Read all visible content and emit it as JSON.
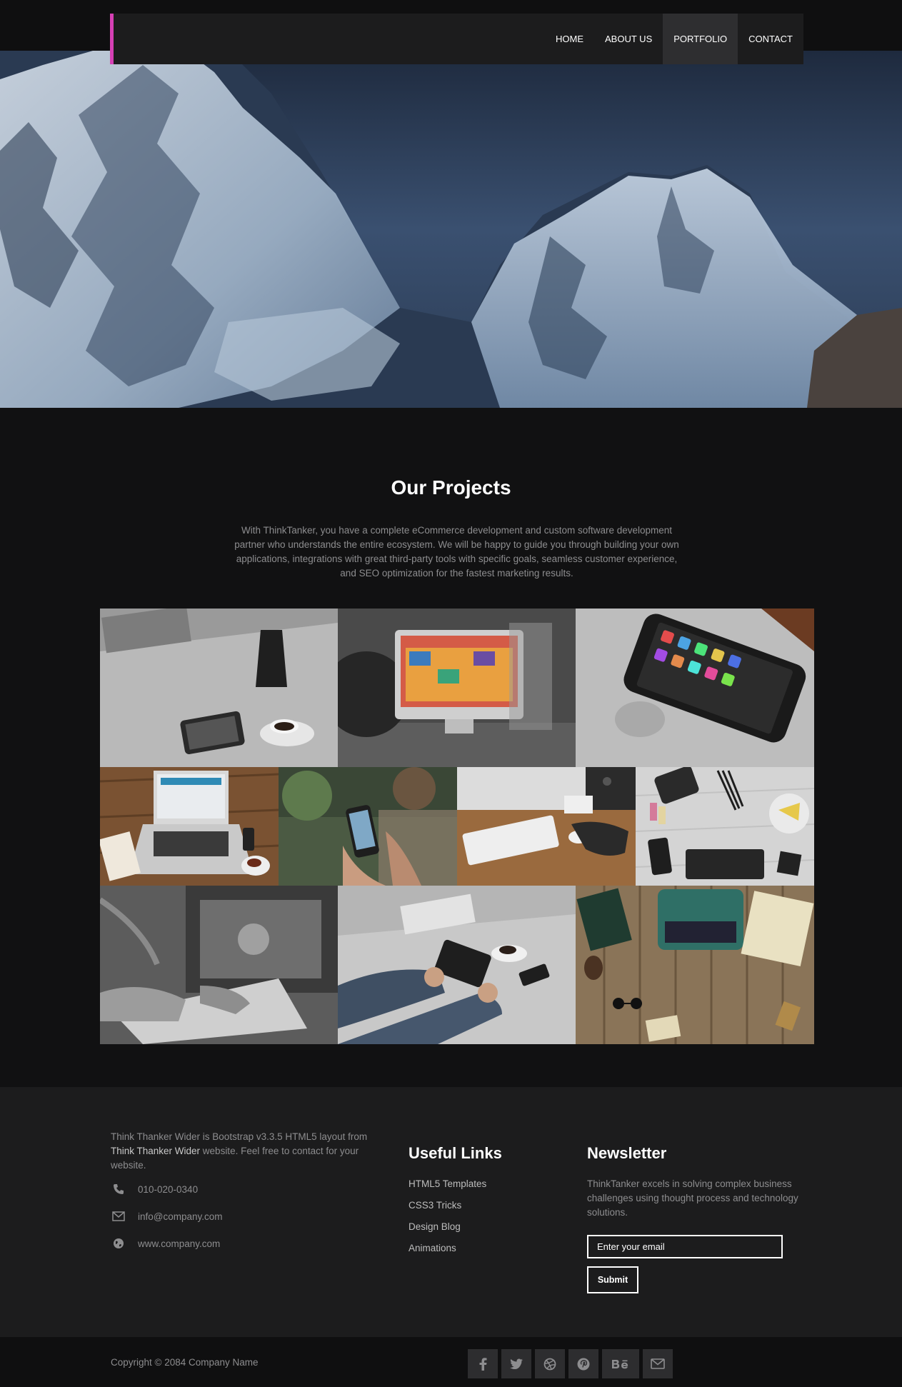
{
  "nav": {
    "items": [
      {
        "label": "HOME",
        "active": false
      },
      {
        "label": "ABOUT US",
        "active": false
      },
      {
        "label": "PORTFOLIO",
        "active": true
      },
      {
        "label": "CONTACT",
        "active": false
      }
    ],
    "accent_color": "#d640b4"
  },
  "hero": {
    "image": "snowy-mountain-range"
  },
  "projects": {
    "title": "Our Projects",
    "description": "With ThinkTanker, you have a complete eCommerce development and custom software development partner who understands the entire ecosystem. We will be happy to guide you through building your own applications, integrations with great third-party tools with specific goals, seamless customer experience, and SEO optimization for the fastest marketing results.",
    "images": [
      "tablet-coffee-desk",
      "imac-workspace",
      "iphone-on-macbook",
      "laptop-wood-desk",
      "phone-in-hands",
      "imac-keyboard-mouse",
      "flatlay-accessories",
      "keyboard-typing-bw",
      "tablet-in-hands",
      "typewriter-wood-desk"
    ]
  },
  "footer": {
    "about_prefix": "Think Thanker Wider is Bootstrap v3.3.5 HTML5 layout from ",
    "about_highlight": "Think Thanker Wider",
    "about_suffix": " website. Feel free to contact for your website.",
    "phone": "010-020-0340",
    "email": "info@company.com",
    "website": "www.company.com",
    "links_title": "Useful Links",
    "links": [
      "HTML5 Templates",
      "CSS3 Tricks",
      "Design Blog",
      "Animations"
    ],
    "newsletter_title": "Newsletter",
    "newsletter_desc": "ThinkTanker excels in solving complex business challenges using thought process and technology solutions.",
    "email_placeholder": "Enter your email",
    "submit_label": "Submit"
  },
  "bottom": {
    "copyright": "Copyright © 2084 Company Name",
    "social": [
      "facebook-icon",
      "twitter-icon",
      "dribbble-icon",
      "pinterest-icon",
      "behance-icon",
      "envelope-icon"
    ]
  }
}
